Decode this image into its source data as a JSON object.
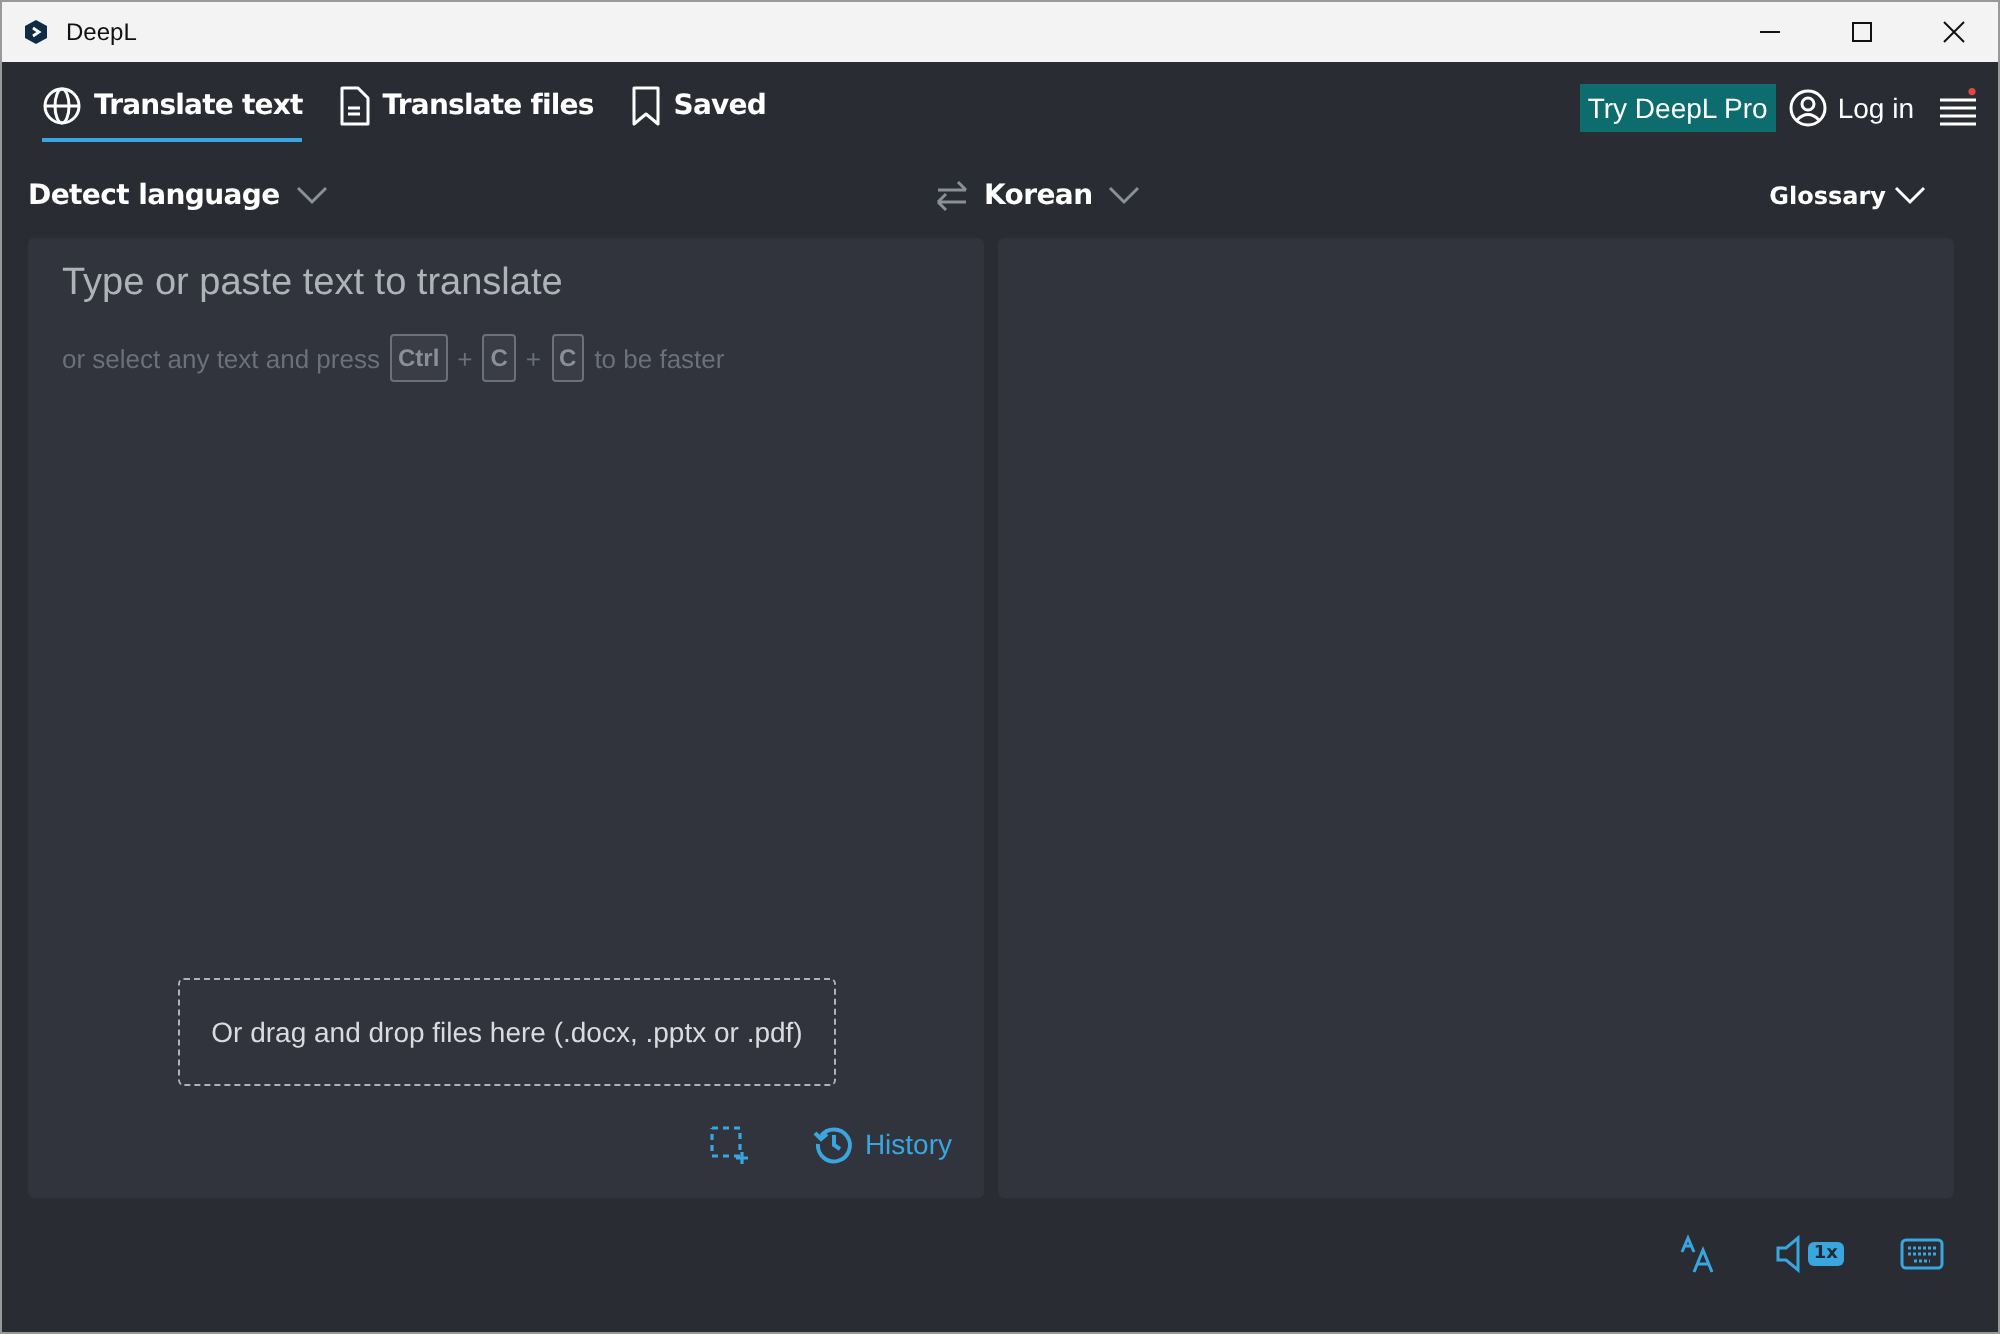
{
  "window": {
    "title": "DeepL"
  },
  "tabs": [
    {
      "label": "Translate text",
      "selected": true
    },
    {
      "label": "Translate files",
      "selected": false
    },
    {
      "label": "Saved",
      "selected": false
    }
  ],
  "pro_button": "Try DeepL Pro",
  "login": "Log in",
  "source_language": "Detect language",
  "target_language": "Korean",
  "glossary": "Glossary",
  "source": {
    "placeholder": "Type or paste text to translate",
    "hint": [
      {
        "kind": "text",
        "text": "or select any text and press"
      },
      {
        "kind": "key",
        "text": "Ctrl"
      },
      {
        "kind": "text",
        "text": "+"
      },
      {
        "kind": "key",
        "text": "C"
      },
      {
        "kind": "text",
        "text": "+"
      },
      {
        "kind": "key",
        "text": "C"
      },
      {
        "kind": "text",
        "text": "to be faster"
      }
    ],
    "drop_zone": "Or drag and drop files here (.docx, .pptx or .pdf)",
    "history": "History"
  },
  "speed": "1x"
}
